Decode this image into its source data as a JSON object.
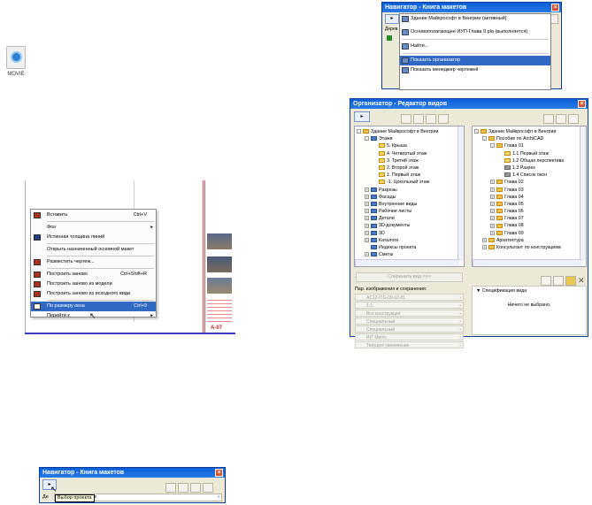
{
  "movie_icon": {
    "label": "MOVIE"
  },
  "nav_top": {
    "title": "Навигатор - Книга макетов",
    "dropdown_items": [
      {
        "label": "Здание Майкрософт в Венгрии (активный)",
        "icon": "project-icon"
      },
      {
        "label": "Основополагающее ИУП-Глава 9.pla (выполняется)",
        "icon": "project-file-icon"
      },
      {
        "label": "Найти...",
        "icon": "folder-open-icon"
      },
      {
        "label": "Показать организатор",
        "icon": "organizer-icon",
        "highlighted": true
      },
      {
        "label": "Показать менеджер чертежей",
        "icon": "drawing-manager-icon"
      }
    ],
    "side_label": "Дерев"
  },
  "context_menu": {
    "items": [
      {
        "label": "Вставить",
        "shortcut": "Ctrl+V",
        "icon": "paste-icon"
      },
      {
        "label": "Фон",
        "submenu": true,
        "icon": ""
      },
      {
        "label": "Истинная толщина линий",
        "icon": "line-weight-icon"
      },
      {
        "label": "Открыть назначенный основной макет",
        "icon": ""
      },
      {
        "label": "Разместить чертеж...",
        "icon": "place-drawing-icon"
      },
      {
        "label": "Построить заново",
        "shortcut": "Ctrl+Shift+R",
        "icon": "rebuild-icon"
      },
      {
        "label": "Построить заново из модели",
        "icon": "rebuild-model-icon"
      },
      {
        "label": "Построить заново из исходного вида",
        "icon": "rebuild-source-icon"
      },
      {
        "label": "По размеру окна",
        "shortcut": "Ctrl+9",
        "icon": "fit-window-icon",
        "highlighted": true
      },
      {
        "label": "Перейти к",
        "submenu": true,
        "icon": ""
      }
    ],
    "sheet_label": "A-07"
  },
  "organizer": {
    "title": "Организатор - Редактор видов",
    "left_tree": [
      {
        "label": "Здание Майкрософт в Венгрии",
        "indent": 0,
        "pm": "-",
        "icon": "building"
      },
      {
        "label": "Этажи",
        "indent": 1,
        "pm": "-",
        "icon": "box"
      },
      {
        "label": "5. Крыша",
        "indent": 2,
        "icon": "floor"
      },
      {
        "label": "4. Четвертый этаж",
        "indent": 2,
        "icon": "floor"
      },
      {
        "label": "3. Третий этаж",
        "indent": 2,
        "icon": "floor"
      },
      {
        "label": "2. Второй этаж",
        "indent": 2,
        "icon": "floor"
      },
      {
        "label": "1. Первый этаж",
        "indent": 2,
        "icon": "floor"
      },
      {
        "label": "-1. Цокольный этаж",
        "indent": 2,
        "icon": "floor"
      },
      {
        "label": "Разрезы",
        "indent": 1,
        "pm": "+",
        "icon": "box"
      },
      {
        "label": "Фасады",
        "indent": 1,
        "pm": "+",
        "icon": "box"
      },
      {
        "label": "Внутренние виды",
        "indent": 1,
        "pm": "+",
        "icon": "box"
      },
      {
        "label": "Рабочие листы",
        "indent": 1,
        "pm": "+",
        "icon": "box"
      },
      {
        "label": "Детали",
        "indent": 1,
        "pm": "+",
        "icon": "box"
      },
      {
        "label": "3D-документы",
        "indent": 1,
        "pm": "+",
        "icon": "box"
      },
      {
        "label": "3D",
        "indent": 1,
        "pm": "+",
        "icon": "box"
      },
      {
        "label": "Каталоги",
        "indent": 1,
        "pm": "+",
        "icon": "box"
      },
      {
        "label": "Индексы проекта",
        "indent": 1,
        "icon": "box"
      },
      {
        "label": "Сметы",
        "indent": 1,
        "pm": "+",
        "icon": "box"
      }
    ],
    "right_tree": [
      {
        "label": "Здание Майкрософт в Венгрии",
        "indent": 0,
        "pm": "-",
        "icon": "building"
      },
      {
        "label": "Пособие по ArchiCAD",
        "indent": 1,
        "pm": "-",
        "icon": "folder"
      },
      {
        "label": "Глава 01",
        "indent": 2,
        "pm": "-",
        "icon": "folder"
      },
      {
        "label": "1.1 Первый этаж",
        "indent": 3,
        "icon": "floor"
      },
      {
        "label": "1.2 Общая перспектива",
        "indent": 3,
        "icon": "camera"
      },
      {
        "label": "1.3 Разрез",
        "indent": 3,
        "icon": "section"
      },
      {
        "label": "1.4 Список окон",
        "indent": 3,
        "icon": "list"
      },
      {
        "label": "Глава 02",
        "indent": 2,
        "pm": "+",
        "icon": "folder"
      },
      {
        "label": "Глава 03",
        "indent": 2,
        "pm": "+",
        "icon": "folder"
      },
      {
        "label": "Глава 04",
        "indent": 2,
        "pm": "+",
        "icon": "folder"
      },
      {
        "label": "Глава 05",
        "indent": 2,
        "pm": "+",
        "icon": "folder"
      },
      {
        "label": "Глава 06",
        "indent": 2,
        "pm": "+",
        "icon": "folder"
      },
      {
        "label": "Глава 07",
        "indent": 2,
        "pm": "+",
        "icon": "folder"
      },
      {
        "label": "Глава 08",
        "indent": 2,
        "pm": "+",
        "icon": "folder"
      },
      {
        "label": "Глава 09",
        "indent": 2,
        "pm": "+",
        "icon": "folder"
      },
      {
        "label": "Архитектура",
        "indent": 1,
        "pm": "+",
        "icon": "folder"
      },
      {
        "label": "Консультант по конструкциям",
        "indent": 1,
        "pm": "+",
        "icon": "folder"
      }
    ],
    "save_button": "Сохранить вид >>>",
    "params_label": "Пар. изображения и сохранения:",
    "fields": [
      "AC12-ITG-09-02-01",
      "1:1",
      "Вся конструкция",
      "Специальный",
      "Специальный",
      "INT Metric",
      "Текущее увеличение"
    ],
    "spec_label": "Спецификация вида",
    "nothing_selected": "Ничего не выбрано."
  },
  "nav_bottom": {
    "title": "Навигатор - Книга макетов",
    "tooltip": "Выбор проекта",
    "dropdown_tail": "ам",
    "side_label": "Де"
  }
}
